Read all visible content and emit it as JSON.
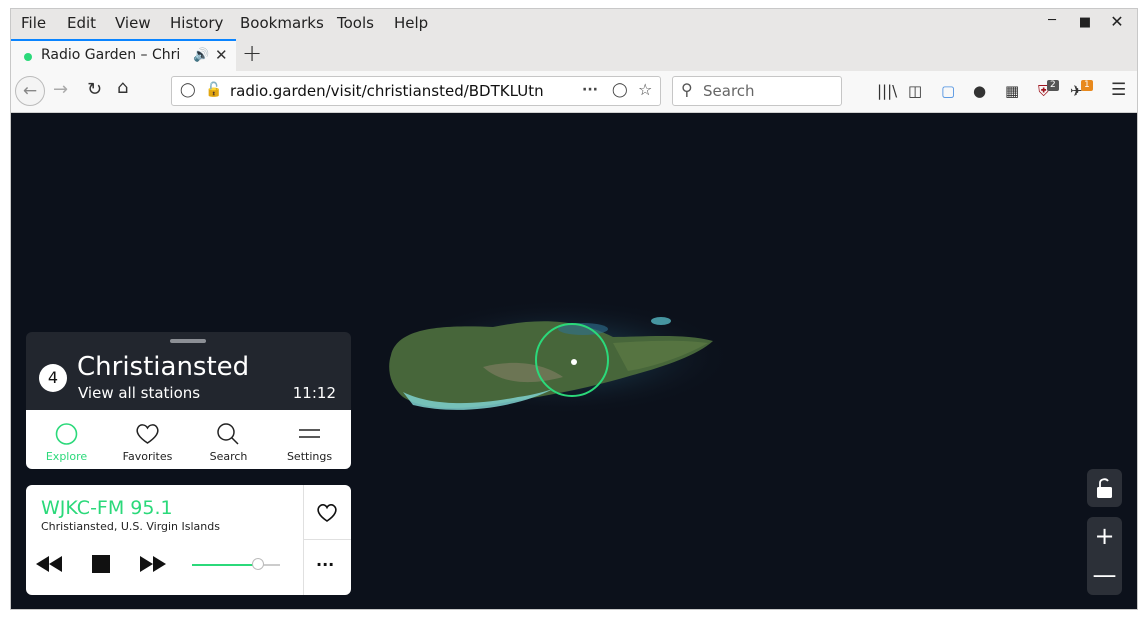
{
  "menubar": {
    "items": [
      {
        "label": "File"
      },
      {
        "label": "Edit"
      },
      {
        "label": "View"
      },
      {
        "label": "History"
      },
      {
        "label": "Bookmarks"
      },
      {
        "label": "Tools"
      },
      {
        "label": "Help"
      }
    ]
  },
  "tab": {
    "title": "Radio Garden – Christi",
    "playing_icon": "speaker-icon"
  },
  "navbar": {
    "url": "radio.garden/visit/christiansted/BDTKLUtn",
    "search_placeholder": "Search",
    "ublock_badge": "2",
    "extension_badge": "1"
  },
  "location_card": {
    "count": "4",
    "place": "Christiansted",
    "view_all": "View all stations",
    "time": "11:12",
    "tabs": [
      {
        "label": "Explore",
        "icon": "explore-circle-icon",
        "active": true
      },
      {
        "label": "Favorites",
        "icon": "heart-icon",
        "active": false
      },
      {
        "label": "Search",
        "icon": "search-icon",
        "active": false
      },
      {
        "label": "Settings",
        "icon": "menu-icon",
        "active": false
      }
    ]
  },
  "player": {
    "station": "WJKC-FM 95.1",
    "location": "Christiansted, U.S. Virgin Islands",
    "volume": 0.75,
    "more_label": "···"
  },
  "colors": {
    "accent": "#2bd97a",
    "panel_dark": "#22262e",
    "map_bg": "#0c111b"
  }
}
